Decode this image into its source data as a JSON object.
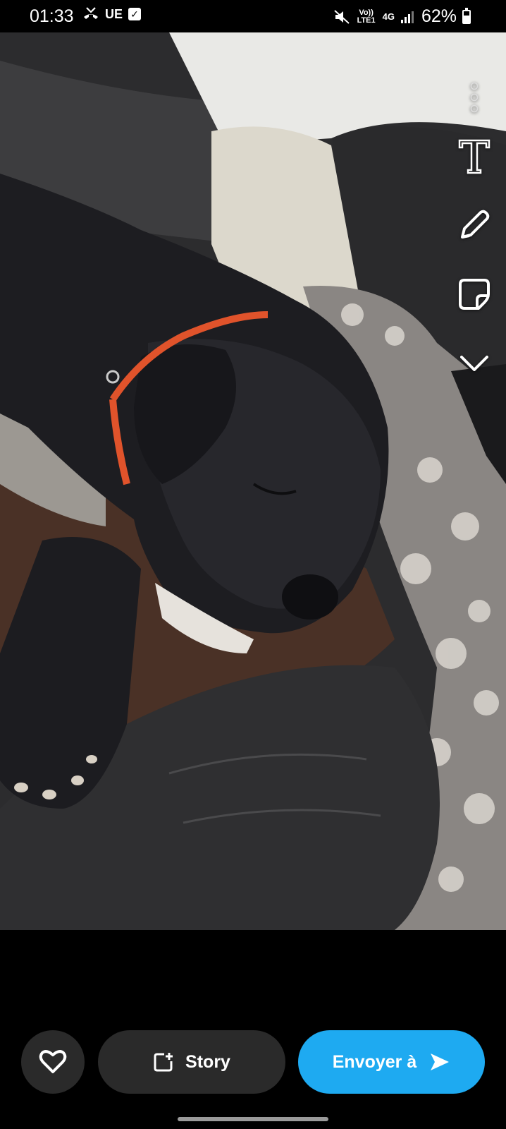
{
  "status_bar": {
    "time": "01:33",
    "carrier_tag": "UE",
    "volte_label": "Vo)) LTE1",
    "network_label": "4G",
    "battery_percent": "62%"
  },
  "photo": {
    "subject": "sleeping dog photo"
  },
  "tools": {
    "items": [
      {
        "name": "more-options-icon"
      },
      {
        "name": "text-tool-icon"
      },
      {
        "name": "pencil-tool-icon"
      },
      {
        "name": "sticker-tool-icon"
      },
      {
        "name": "expand-tools-icon"
      }
    ]
  },
  "actions": {
    "story_label": "Story",
    "send_label": "Envoyer à"
  },
  "colors": {
    "send_button": "#1eaaf1",
    "secondary_button": "#2a2a2a",
    "background": "#000000"
  }
}
